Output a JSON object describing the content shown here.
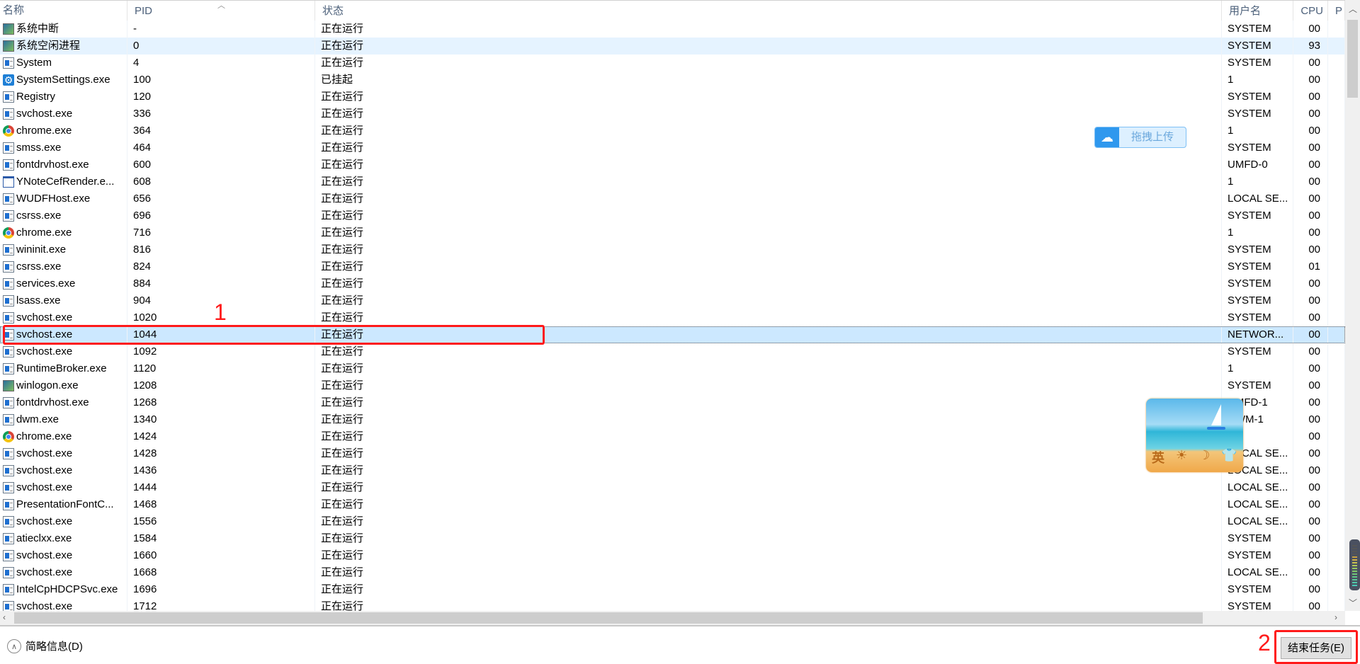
{
  "columns": {
    "name": "名称",
    "pid": "PID",
    "status": "状态",
    "user": "用户名",
    "cpu": "CPU",
    "p": "P"
  },
  "rows": [
    {
      "icon": "sys",
      "name": "系统中断",
      "pid": "-",
      "status": "正在运行",
      "user": "SYSTEM",
      "cpu": "00"
    },
    {
      "icon": "sys",
      "name": "系统空闲进程",
      "pid": "0",
      "status": "正在运行",
      "user": "SYSTEM",
      "cpu": "93",
      "hover": true
    },
    {
      "icon": "app",
      "name": "System",
      "pid": "4",
      "status": "正在运行",
      "user": "SYSTEM",
      "cpu": "00"
    },
    {
      "icon": "gear",
      "name": "SystemSettings.exe",
      "pid": "100",
      "status": "已挂起",
      "user": "1",
      "cpu": "00"
    },
    {
      "icon": "app",
      "name": "Registry",
      "pid": "120",
      "status": "正在运行",
      "user": "SYSTEM",
      "cpu": "00"
    },
    {
      "icon": "app",
      "name": "svchost.exe",
      "pid": "336",
      "status": "正在运行",
      "user": "SYSTEM",
      "cpu": "00"
    },
    {
      "icon": "chrome",
      "name": "chrome.exe",
      "pid": "364",
      "status": "正在运行",
      "user": "1",
      "cpu": "00"
    },
    {
      "icon": "app",
      "name": "smss.exe",
      "pid": "464",
      "status": "正在运行",
      "user": "SYSTEM",
      "cpu": "00"
    },
    {
      "icon": "app",
      "name": "fontdrvhost.exe",
      "pid": "600",
      "status": "正在运行",
      "user": "UMFD-0",
      "cpu": "00"
    },
    {
      "icon": "win",
      "name": "YNoteCefRender.e...",
      "pid": "608",
      "status": "正在运行",
      "user": "1",
      "cpu": "00"
    },
    {
      "icon": "app",
      "name": "WUDFHost.exe",
      "pid": "656",
      "status": "正在运行",
      "user": "LOCAL SE...",
      "cpu": "00"
    },
    {
      "icon": "app",
      "name": "csrss.exe",
      "pid": "696",
      "status": "正在运行",
      "user": "SYSTEM",
      "cpu": "00"
    },
    {
      "icon": "chrome",
      "name": "chrome.exe",
      "pid": "716",
      "status": "正在运行",
      "user": "1",
      "cpu": "00"
    },
    {
      "icon": "app",
      "name": "wininit.exe",
      "pid": "816",
      "status": "正在运行",
      "user": "SYSTEM",
      "cpu": "00"
    },
    {
      "icon": "app",
      "name": "csrss.exe",
      "pid": "824",
      "status": "正在运行",
      "user": "SYSTEM",
      "cpu": "01"
    },
    {
      "icon": "app",
      "name": "services.exe",
      "pid": "884",
      "status": "正在运行",
      "user": "SYSTEM",
      "cpu": "00"
    },
    {
      "icon": "app",
      "name": "lsass.exe",
      "pid": "904",
      "status": "正在运行",
      "user": "SYSTEM",
      "cpu": "00"
    },
    {
      "icon": "app",
      "name": "svchost.exe",
      "pid": "1020",
      "status": "正在运行",
      "user": "SYSTEM",
      "cpu": "00"
    },
    {
      "icon": "app",
      "name": "svchost.exe",
      "pid": "1044",
      "status": "正在运行",
      "user": "NETWOR...",
      "cpu": "00",
      "selected": true
    },
    {
      "icon": "app",
      "name": "svchost.exe",
      "pid": "1092",
      "status": "正在运行",
      "user": "SYSTEM",
      "cpu": "00"
    },
    {
      "icon": "app",
      "name": "RuntimeBroker.exe",
      "pid": "1120",
      "status": "正在运行",
      "user": "1",
      "cpu": "00"
    },
    {
      "icon": "sys",
      "name": "winlogon.exe",
      "pid": "1208",
      "status": "正在运行",
      "user": "SYSTEM",
      "cpu": "00"
    },
    {
      "icon": "app",
      "name": "fontdrvhost.exe",
      "pid": "1268",
      "status": "正在运行",
      "user": "UMFD-1",
      "cpu": "00"
    },
    {
      "icon": "app",
      "name": "dwm.exe",
      "pid": "1340",
      "status": "正在运行",
      "user": "DWM-1",
      "cpu": "00"
    },
    {
      "icon": "chrome",
      "name": "chrome.exe",
      "pid": "1424",
      "status": "正在运行",
      "user": "",
      "cpu": "00"
    },
    {
      "icon": "app",
      "name": "svchost.exe",
      "pid": "1428",
      "status": "正在运行",
      "user": "LOCAL SE...",
      "cpu": "00"
    },
    {
      "icon": "app",
      "name": "svchost.exe",
      "pid": "1436",
      "status": "正在运行",
      "user": "LOCAL SE...",
      "cpu": "00"
    },
    {
      "icon": "app",
      "name": "svchost.exe",
      "pid": "1444",
      "status": "正在运行",
      "user": "LOCAL SE...",
      "cpu": "00"
    },
    {
      "icon": "app",
      "name": "PresentationFontC...",
      "pid": "1468",
      "status": "正在运行",
      "user": "LOCAL SE...",
      "cpu": "00"
    },
    {
      "icon": "app",
      "name": "svchost.exe",
      "pid": "1556",
      "status": "正在运行",
      "user": "LOCAL SE...",
      "cpu": "00"
    },
    {
      "icon": "app",
      "name": "atieclxx.exe",
      "pid": "1584",
      "status": "正在运行",
      "user": "SYSTEM",
      "cpu": "00"
    },
    {
      "icon": "app",
      "name": "svchost.exe",
      "pid": "1660",
      "status": "正在运行",
      "user": "SYSTEM",
      "cpu": "00"
    },
    {
      "icon": "app",
      "name": "svchost.exe",
      "pid": "1668",
      "status": "正在运行",
      "user": "LOCAL SE...",
      "cpu": "00"
    },
    {
      "icon": "app",
      "name": "IntelCpHDCPSvc.exe",
      "pid": "1696",
      "status": "正在运行",
      "user": "SYSTEM",
      "cpu": "00"
    },
    {
      "icon": "app",
      "name": "svchost.exe",
      "pid": "1712",
      "status": "正在运行",
      "user": "SYSTEM",
      "cpu": "00"
    }
  ],
  "footer": {
    "brief_label": "简略信息(D)",
    "end_task_label": "结束任务(E)"
  },
  "annotations": {
    "label1": "1",
    "label2": "2",
    "color": "#ff1a1a"
  },
  "upload_widget": {
    "label": "拖拽上传"
  },
  "ime_widget": {
    "chars": [
      "英",
      "☀",
      "☽",
      "👕"
    ]
  },
  "colors": {
    "selected_row": "#cce8ff",
    "hover_row": "#e5f3ff",
    "header_text": "#4c607a"
  }
}
